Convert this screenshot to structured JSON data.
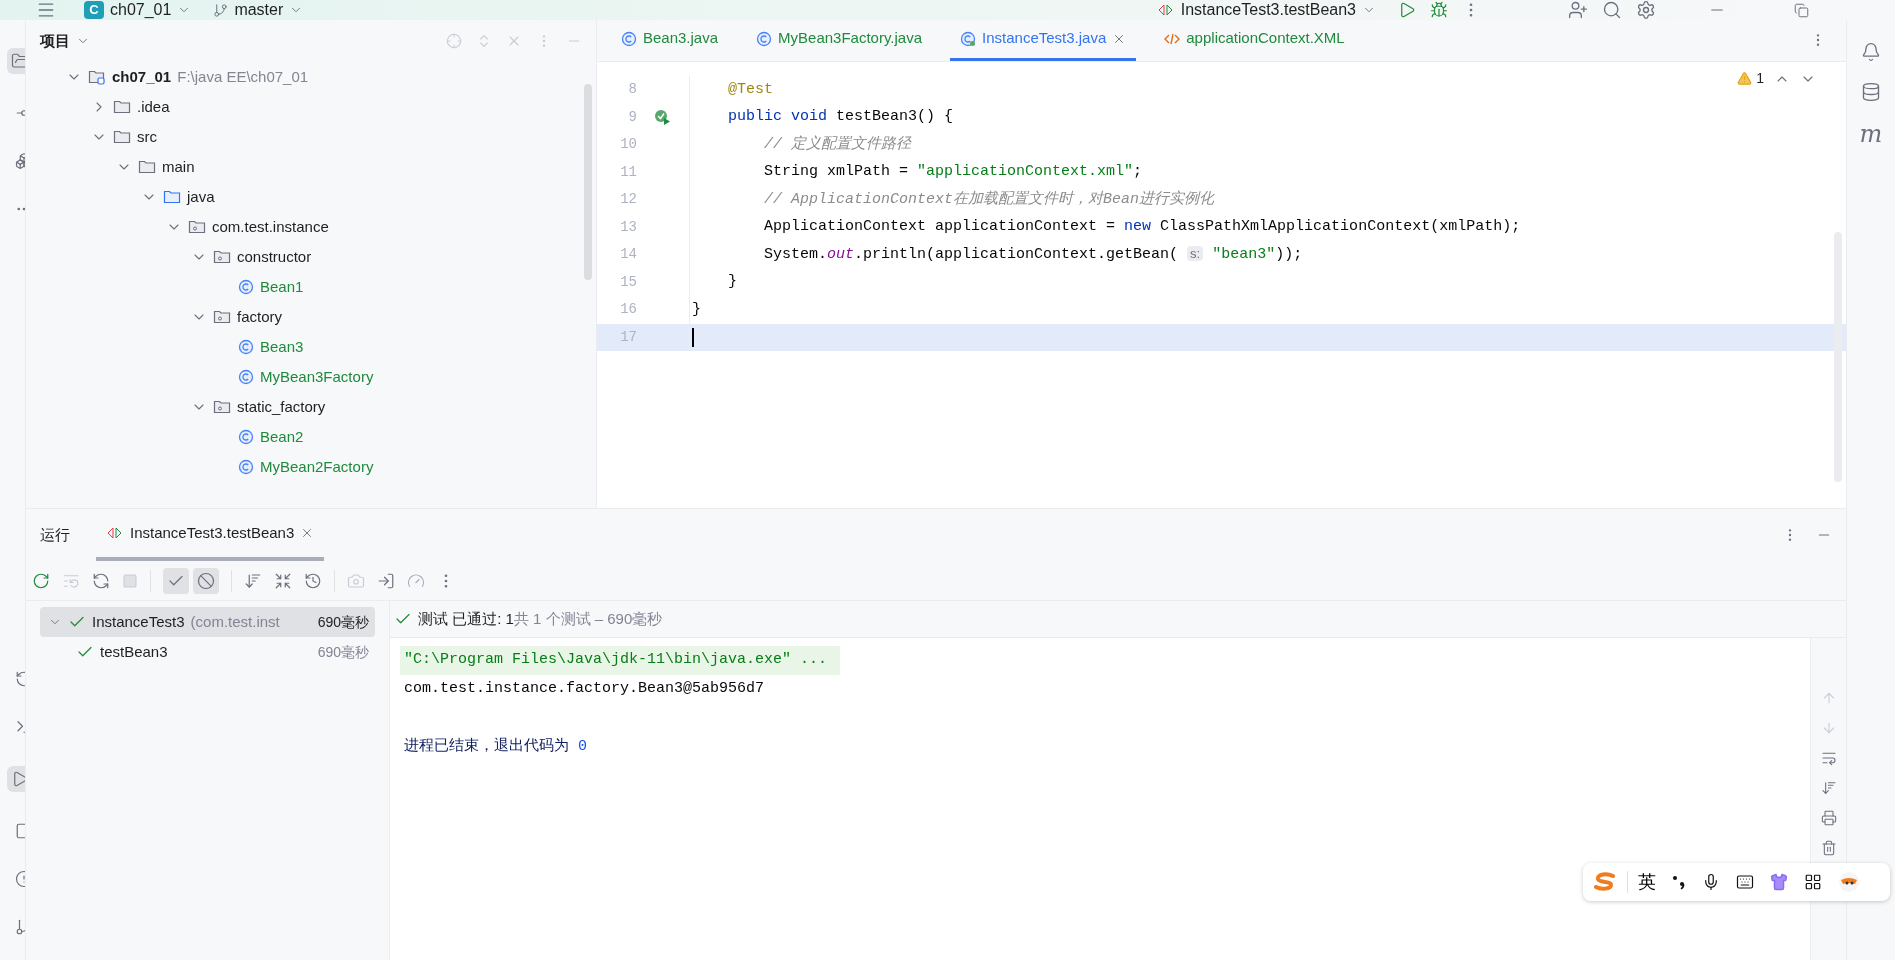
{
  "title_bar": {
    "project_badge": "C",
    "project": "ch07_01",
    "branch": "master",
    "run_config": "InstanceTest3.testBean3"
  },
  "project_panel": {
    "title": "项目",
    "tree": [
      {
        "name": "ch07_01",
        "kind": "module",
        "path": "F:\\java EE\\ch07_01",
        "expanded": true,
        "children": [
          {
            "name": ".idea",
            "kind": "folder",
            "expanded": false
          },
          {
            "name": "src",
            "kind": "folder",
            "expanded": true,
            "children": [
              {
                "name": "main",
                "kind": "folder",
                "expanded": true,
                "children": [
                  {
                    "name": "java",
                    "kind": "source",
                    "expanded": true,
                    "children": [
                      {
                        "name": "com.test.instance",
                        "kind": "package",
                        "expanded": true,
                        "children": [
                          {
                            "name": "constructor",
                            "kind": "package",
                            "expanded": true,
                            "children": [
                              {
                                "name": "Bean1",
                                "kind": "class"
                              }
                            ]
                          },
                          {
                            "name": "factory",
                            "kind": "package",
                            "expanded": true,
                            "children": [
                              {
                                "name": "Bean3",
                                "kind": "class"
                              },
                              {
                                "name": "MyBean3Factory",
                                "kind": "class"
                              }
                            ]
                          },
                          {
                            "name": "static_factory",
                            "kind": "package",
                            "expanded": true,
                            "children": [
                              {
                                "name": "Bean2",
                                "kind": "class"
                              },
                              {
                                "name": "MyBean2Factory",
                                "kind": "class"
                              }
                            ]
                          }
                        ]
                      }
                    ]
                  }
                ]
              }
            ]
          }
        ]
      }
    ]
  },
  "editor": {
    "tabs": [
      {
        "label": "Bean3.java",
        "kind": "class",
        "selected": false
      },
      {
        "label": "MyBean3Factory.java",
        "kind": "class",
        "selected": false
      },
      {
        "label": "InstanceTest3.java",
        "kind": "test",
        "selected": true
      },
      {
        "label": "applicationContext.XML",
        "kind": "xml",
        "selected": false
      }
    ],
    "warning_count": "1",
    "lines": [
      {
        "number": "8",
        "run_marker": false,
        "current": false,
        "tokens": [
          {
            "kind": "annotation",
            "text": "    @Test"
          }
        ]
      },
      {
        "number": "9",
        "run_marker": true,
        "current": false,
        "tokens": [
          {
            "kind": "keyword",
            "text": "    public void "
          },
          {
            "kind": "plain",
            "text": "testBean3() {"
          }
        ]
      },
      {
        "number": "10",
        "run_marker": false,
        "current": false,
        "tokens": [
          {
            "kind": "comment",
            "text": "        // 定义配置文件路径"
          }
        ]
      },
      {
        "number": "11",
        "run_marker": false,
        "current": false,
        "tokens": [
          {
            "kind": "plain",
            "text": "        String xmlPath = "
          },
          {
            "kind": "string",
            "text": "\"applicationContext.xml\""
          },
          {
            "kind": "plain",
            "text": ";"
          }
        ]
      },
      {
        "number": "12",
        "run_marker": false,
        "current": false,
        "tokens": [
          {
            "kind": "comment",
            "text": "        // ApplicationContext在加载配置文件时，对Bean进行实例化"
          }
        ]
      },
      {
        "number": "13",
        "run_marker": false,
        "current": false,
        "tokens": [
          {
            "kind": "plain",
            "text": "        ApplicationContext applicationContext = "
          },
          {
            "kind": "keyword",
            "text": "new "
          },
          {
            "kind": "plain",
            "text": "ClassPathXmlApplicationContext(xmlPath);"
          }
        ]
      },
      {
        "number": "14",
        "run_marker": false,
        "current": false,
        "tokens": [
          {
            "kind": "plain",
            "text": "        System."
          },
          {
            "kind": "static",
            "text": "out"
          },
          {
            "kind": "plain",
            "text": ".println(applicationContext.getBean( "
          },
          {
            "kind": "hint",
            "text": "s:"
          },
          {
            "kind": "string",
            "text": " \"bean3\""
          },
          {
            "kind": "plain",
            "text": "));"
          }
        ]
      },
      {
        "number": "15",
        "run_marker": false,
        "current": false,
        "tokens": [
          {
            "kind": "plain",
            "text": "    }"
          }
        ]
      },
      {
        "number": "16",
        "run_marker": false,
        "current": false,
        "tokens": [
          {
            "kind": "plain",
            "text": "}"
          }
        ]
      },
      {
        "number": "17",
        "run_marker": false,
        "current": true
      }
    ]
  },
  "run_panel": {
    "label": "运行",
    "tabs": [
      {
        "label": "InstanceTest3.testBean3",
        "selected": true
      }
    ],
    "toolbar": {
      "show_passed": true,
      "show_ignored": true
    },
    "tests": [
      {
        "name": "InstanceTest3",
        "detail": "(com.test.inst",
        "time": "690毫秒",
        "passed": true,
        "selected": true,
        "children": [
          {
            "name": "testBean3",
            "time": "690毫秒",
            "passed": true,
            "selected": false
          }
        ]
      }
    ],
    "status": {
      "passed": "测试 已通过: 1",
      "summary": "共 1 个测试 – 690毫秒"
    },
    "console": [
      {
        "kind": "command",
        "text": "\"C:\\Program Files\\Java\\jdk-11\\bin\\java.exe\" ..."
      },
      {
        "kind": "output",
        "text": "com.test.instance.factory.Bean3@5ab956d7"
      },
      {
        "kind": "blank"
      },
      {
        "kind": "exit",
        "text": "进程已结束，退出代码为 ",
        "code": "0"
      }
    ]
  },
  "right_strip": {
    "maven_glyph": "m"
  },
  "ime_bar": {
    "mode": "英"
  }
}
